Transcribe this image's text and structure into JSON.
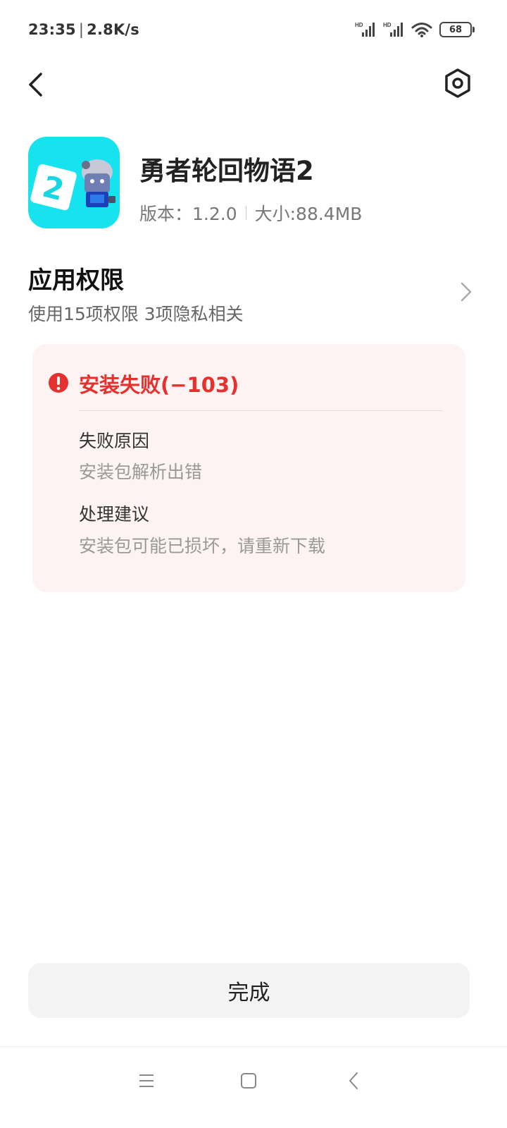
{
  "status_bar": {
    "time": "23:35",
    "network_speed": "2.8K/s",
    "signal1_label": "HD",
    "signal2_label": "HD",
    "battery_level": "68"
  },
  "top_nav": {
    "back_icon": "chevron-left-icon",
    "settings_icon": "hexagon-settings-icon"
  },
  "app": {
    "name": "勇者轮回物语2",
    "version_label": "版本：1.2.0",
    "size_label": "大小:88.4MB",
    "icon_color": "#17e3ee"
  },
  "permissions": {
    "title": "应用权限",
    "subtitle": "使用15项权限 3项隐私相关"
  },
  "error": {
    "title": "安装失败(−103)",
    "color": "#e5302d",
    "reason_label": "失败原因",
    "reason_value": "安装包解析出错",
    "suggestion_label": "处理建议",
    "suggestion_value": "安装包可能已损坏，请重新下载"
  },
  "done_button": {
    "label": "完成"
  },
  "nav_bar": {
    "menu_icon": "menu-icon",
    "home_icon": "home-icon",
    "back_icon": "back-icon"
  }
}
